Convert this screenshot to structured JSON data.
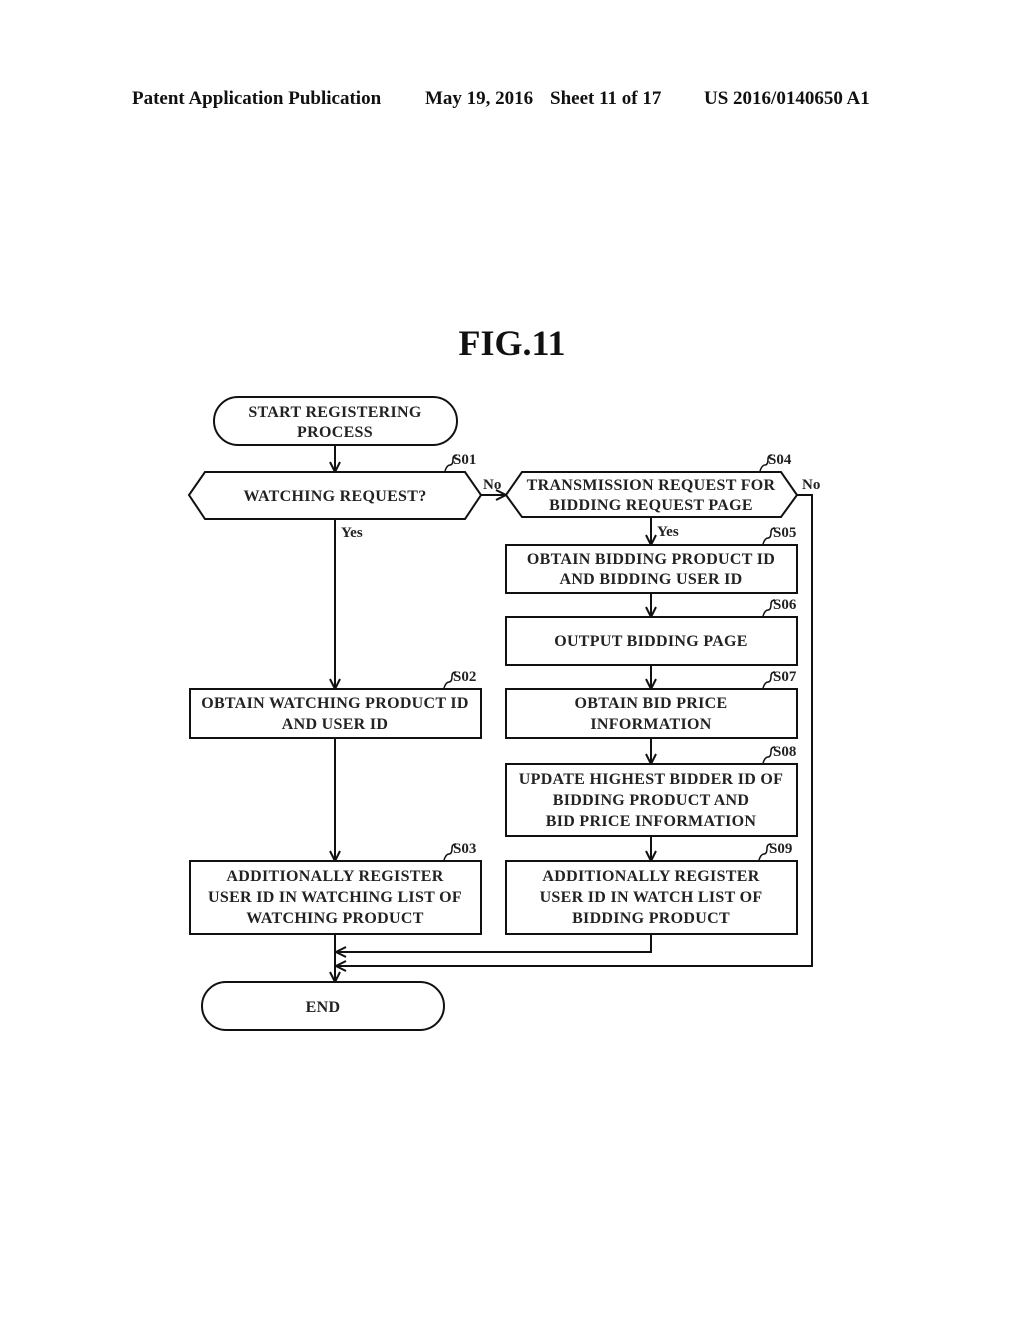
{
  "header": {
    "publication": "Patent Application Publication",
    "date": "May 19, 2016",
    "sheet": "Sheet 11 of 17",
    "number": "US 2016/0140650 A1"
  },
  "figure": {
    "title": "FIG.11"
  },
  "flowchart": {
    "start": {
      "lines": [
        "START REGISTERING",
        "PROCESS"
      ]
    },
    "end": {
      "lines": [
        "END"
      ]
    },
    "steps": {
      "S01": {
        "label": "S01",
        "type": "decision",
        "lines": [
          "WATCHING REQUEST?"
        ]
      },
      "S02": {
        "label": "S02",
        "type": "process",
        "lines": [
          "OBTAIN WATCHING PRODUCT ID",
          "AND USER ID"
        ]
      },
      "S03": {
        "label": "S03",
        "type": "process",
        "lines": [
          "ADDITIONALLY REGISTER",
          "USER ID IN WATCHING LIST OF",
          "WATCHING PRODUCT"
        ]
      },
      "S04": {
        "label": "S04",
        "type": "decision",
        "lines": [
          "TRANSMISSION REQUEST FOR",
          "BIDDING REQUEST PAGE"
        ]
      },
      "S05": {
        "label": "S05",
        "type": "process",
        "lines": [
          "OBTAIN BIDDING PRODUCT ID",
          "AND BIDDING USER ID"
        ]
      },
      "S06": {
        "label": "S06",
        "type": "process",
        "lines": [
          "OUTPUT BIDDING PAGE"
        ]
      },
      "S07": {
        "label": "S07",
        "type": "process",
        "lines": [
          "OBTAIN BID PRICE",
          "INFORMATION"
        ]
      },
      "S08": {
        "label": "S08",
        "type": "process",
        "lines": [
          "UPDATE HIGHEST BIDDER ID OF",
          "BIDDING PRODUCT AND",
          "BID PRICE INFORMATION"
        ]
      },
      "S09": {
        "label": "S09",
        "type": "process",
        "lines": [
          "ADDITIONALLY REGISTER",
          "USER ID IN WATCH LIST OF",
          "BIDDING PRODUCT"
        ]
      }
    },
    "branches": {
      "s01_yes": "Yes",
      "s01_no": "No",
      "s04_yes": "Yes",
      "s04_no": "No"
    },
    "edges": [
      {
        "from": "start",
        "to": "S01"
      },
      {
        "from": "S01",
        "to": "S02",
        "label": "Yes"
      },
      {
        "from": "S01",
        "to": "S04",
        "label": "No"
      },
      {
        "from": "S02",
        "to": "S03"
      },
      {
        "from": "S03",
        "to": "end"
      },
      {
        "from": "S04",
        "to": "S05",
        "label": "Yes"
      },
      {
        "from": "S04",
        "to": "end",
        "label": "No"
      },
      {
        "from": "S05",
        "to": "S06"
      },
      {
        "from": "S06",
        "to": "S07"
      },
      {
        "from": "S07",
        "to": "S08"
      },
      {
        "from": "S08",
        "to": "S09"
      },
      {
        "from": "S09",
        "to": "end"
      }
    ]
  }
}
